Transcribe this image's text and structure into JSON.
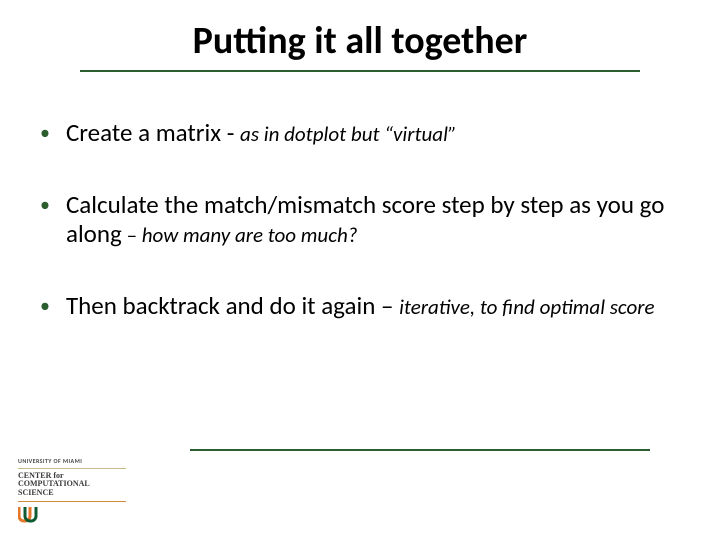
{
  "title": "Putting it all together",
  "bullets": [
    {
      "main": "Create a matrix",
      "sep": "  - ",
      "note": "as in dotplot but “virtual”"
    },
    {
      "main": "Calculate the match/mismatch score step by step as you go along",
      "sep": " – ",
      "note": "how many are too much?"
    },
    {
      "main": "Then backtrack and do it again",
      "sep": " – ",
      "note": "iterative, to find optimal score"
    }
  ],
  "logo": {
    "university": "UNIVERSITY OF MIAMI",
    "center_l1": "CENTER for",
    "center_l2": "COMPUTATIONAL",
    "center_l3": "SCIENCE"
  },
  "colors": {
    "accent": "#2b5d2e",
    "u_orange": "#e77626",
    "u_green": "#0e5b33"
  }
}
